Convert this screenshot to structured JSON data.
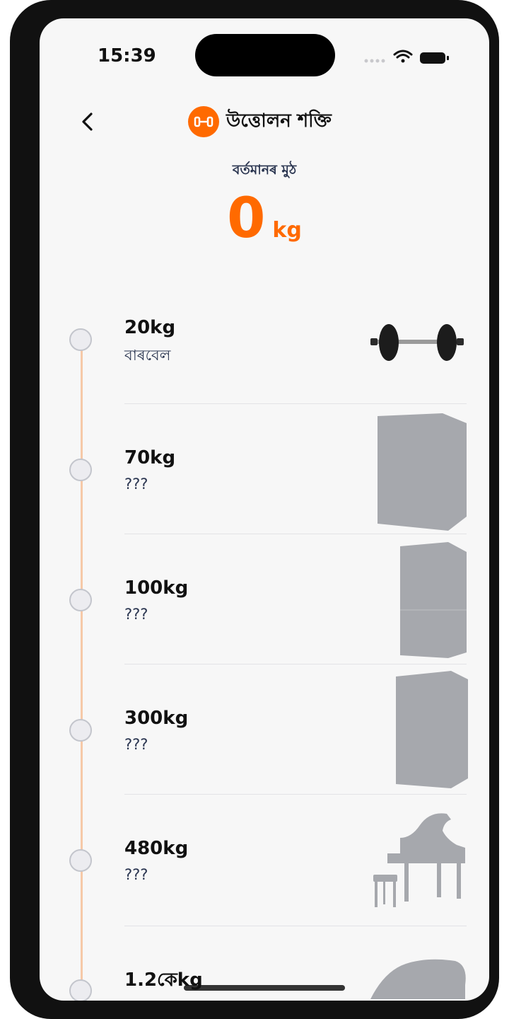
{
  "status": {
    "time": "15:39"
  },
  "header": {
    "title": "উত্তোলন শক্তি"
  },
  "current": {
    "label": "বৰ্তমানৰ মুঠ",
    "value": "0",
    "unit": "kg"
  },
  "items": [
    {
      "weight": "20kg",
      "name": "বাৰবেল",
      "thumb_icon": "barbell-icon"
    },
    {
      "weight": "70kg",
      "name": "???",
      "thumb_icon": "locked-item-silhouette-icon"
    },
    {
      "weight": "100kg",
      "name": "???",
      "thumb_icon": "locked-item-silhouette-icon"
    },
    {
      "weight": "300kg",
      "name": "???",
      "thumb_icon": "locked-item-silhouette-icon"
    },
    {
      "weight": "480kg",
      "name": "???",
      "thumb_icon": "piano-silhouette-icon"
    },
    {
      "weight": "1.2কেkg",
      "name": "",
      "thumb_icon": "locked-item-silhouette-icon"
    }
  ],
  "colors": {
    "accent": "#ff6a00",
    "timeline": "#f6c9a8",
    "silhouette": "#a6a8ad"
  }
}
